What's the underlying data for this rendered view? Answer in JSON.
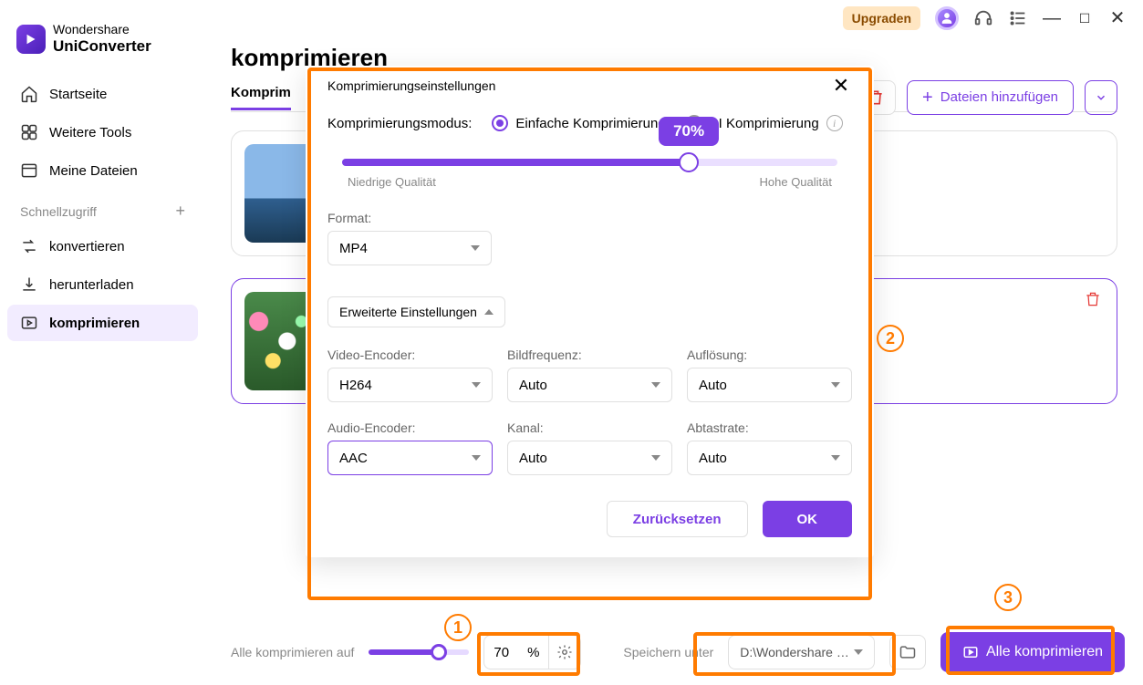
{
  "titlebar": {
    "upgrade": "Upgraden"
  },
  "sidebar": {
    "brand_top": "Wondershare",
    "brand_bottom": "UniConverter",
    "items": [
      {
        "label": "Startseite"
      },
      {
        "label": "Weitere Tools"
      },
      {
        "label": "Meine Dateien"
      }
    ],
    "quick_label": "Schnellzugriff",
    "quick_items": [
      {
        "label": "konvertieren"
      },
      {
        "label": "herunterladen"
      },
      {
        "label": "komprimieren"
      }
    ]
  },
  "main": {
    "title": "komprimieren",
    "tab": "Komprim",
    "delete_tooltip": "delete",
    "add_files": "Dateien hinzufügen"
  },
  "modal": {
    "title": "Komprimierungseinstellungen",
    "mode_label": "Komprimierungsmodus:",
    "mode_simple": "Einfache Komprimierung",
    "mode_ai": "AI Komprimierung",
    "slider_value": "70%",
    "slider_percent": 70,
    "low_quality": "Niedrige Qualität",
    "high_quality": "Hohe Qualität",
    "format_label": "Format:",
    "format_value": "MP4",
    "expand_label": "Erweiterte Einstellungen",
    "video_encoder_label": "Video-Encoder:",
    "video_encoder_value": "H264",
    "bildfrequenz_label": "Bildfrequenz:",
    "bildfrequenz_value": "Auto",
    "aufloesung_label": "Auflösung:",
    "aufloesung_value": "Auto",
    "audio_encoder_label": "Audio-Encoder:",
    "audio_encoder_value": "AAC",
    "kanal_label": "Kanal:",
    "kanal_value": "Auto",
    "abtastrate_label": "Abtastrate:",
    "abtastrate_value": "Auto",
    "reset": "Zurücksetzen",
    "ok": "OK"
  },
  "footer": {
    "compress_all_to": "Alle komprimieren auf",
    "percent_value": "70",
    "percent_unit": "%",
    "save_label": "Speichern unter",
    "save_path": "D:\\Wondershare UniConve",
    "button": "Alle komprimieren"
  },
  "annotations": {
    "n1": "1",
    "n2": "2",
    "n3": "3"
  }
}
